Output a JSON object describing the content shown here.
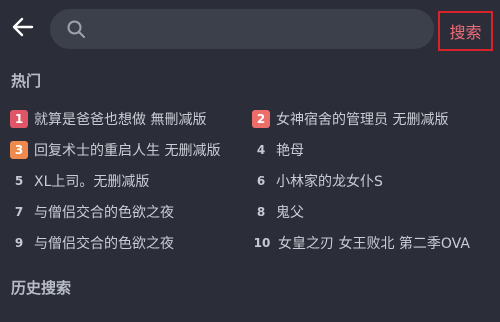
{
  "search": {
    "value": "",
    "placeholder": "",
    "button_label": "搜索"
  },
  "hot": {
    "title": "热门",
    "items": [
      {
        "rank": "1",
        "text": "就算是爸爸也想做 無刪减版",
        "badge_color": "#e05667"
      },
      {
        "rank": "2",
        "text": "女神宿舍的管理员 无删减版",
        "badge_color": "#ed6d6a"
      },
      {
        "rank": "3",
        "text": "回复术士的重启人生 无删减版",
        "badge_color": "#ef8a4e"
      },
      {
        "rank": "4",
        "text": "艳母",
        "badge_color": ""
      },
      {
        "rank": "5",
        "text": "XL上司。无删减版",
        "badge_color": ""
      },
      {
        "rank": "6",
        "text": "小林家的龙女仆S",
        "badge_color": ""
      },
      {
        "rank": "7",
        "text": "与僧侣交合的色欲之夜",
        "badge_color": ""
      },
      {
        "rank": "8",
        "text": "鬼父",
        "badge_color": ""
      },
      {
        "rank": "9",
        "text": "与僧侣交合的色欲之夜",
        "badge_color": ""
      },
      {
        "rank": "10",
        "text": "女皇之刃 女王败北 第二季OVA",
        "badge_color": ""
      }
    ]
  },
  "history": {
    "title": "历史搜索"
  },
  "colors": {
    "background": "#2b2e38",
    "search_box": "#3c404b",
    "accent": "#f06b7a",
    "highlight_border": "#d8232a"
  },
  "icons": {
    "back": "arrow-left-icon",
    "search": "search-icon"
  }
}
